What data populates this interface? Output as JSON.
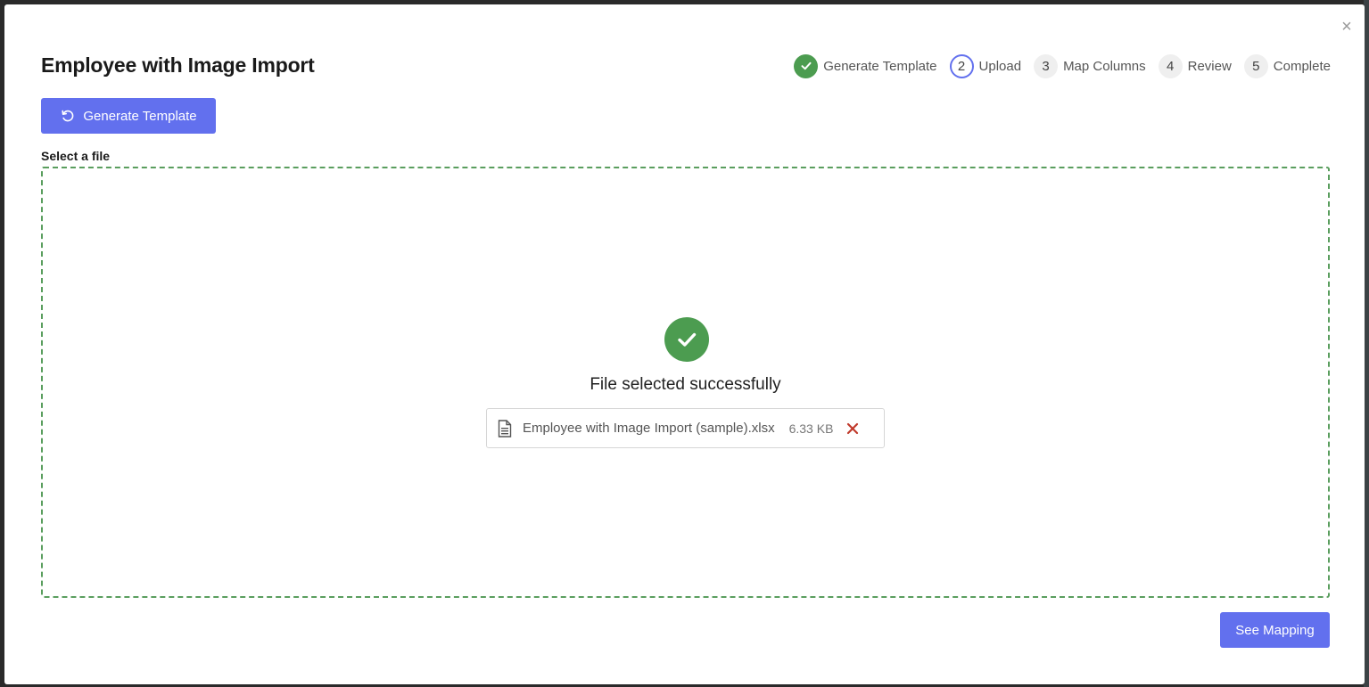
{
  "modal": {
    "title": "Employee with Image Import",
    "close_icon": "close-icon"
  },
  "steps": [
    {
      "number": "",
      "label": "Generate Template",
      "state": "done",
      "icon": "check-icon"
    },
    {
      "number": "2",
      "label": "Upload",
      "state": "active"
    },
    {
      "number": "3",
      "label": "Map Columns",
      "state": "pending"
    },
    {
      "number": "4",
      "label": "Review",
      "state": "pending"
    },
    {
      "number": "5",
      "label": "Complete",
      "state": "pending"
    }
  ],
  "toolbar": {
    "generate_label": "Generate Template",
    "generate_icon": "refresh-icon"
  },
  "upload": {
    "select_label": "Select a file",
    "success_text": "File selected successfully",
    "file": {
      "name": "Employee with Image Import (sample).xlsx",
      "size": "6.33 KB",
      "icon": "file-icon",
      "remove_icon": "remove-icon"
    }
  },
  "footer": {
    "see_mapping_label": "See Mapping"
  },
  "colors": {
    "accent": "#6270ee",
    "success": "#4c9c50",
    "danger": "#c0392b",
    "dropzone_border": "#5a9e5e"
  }
}
